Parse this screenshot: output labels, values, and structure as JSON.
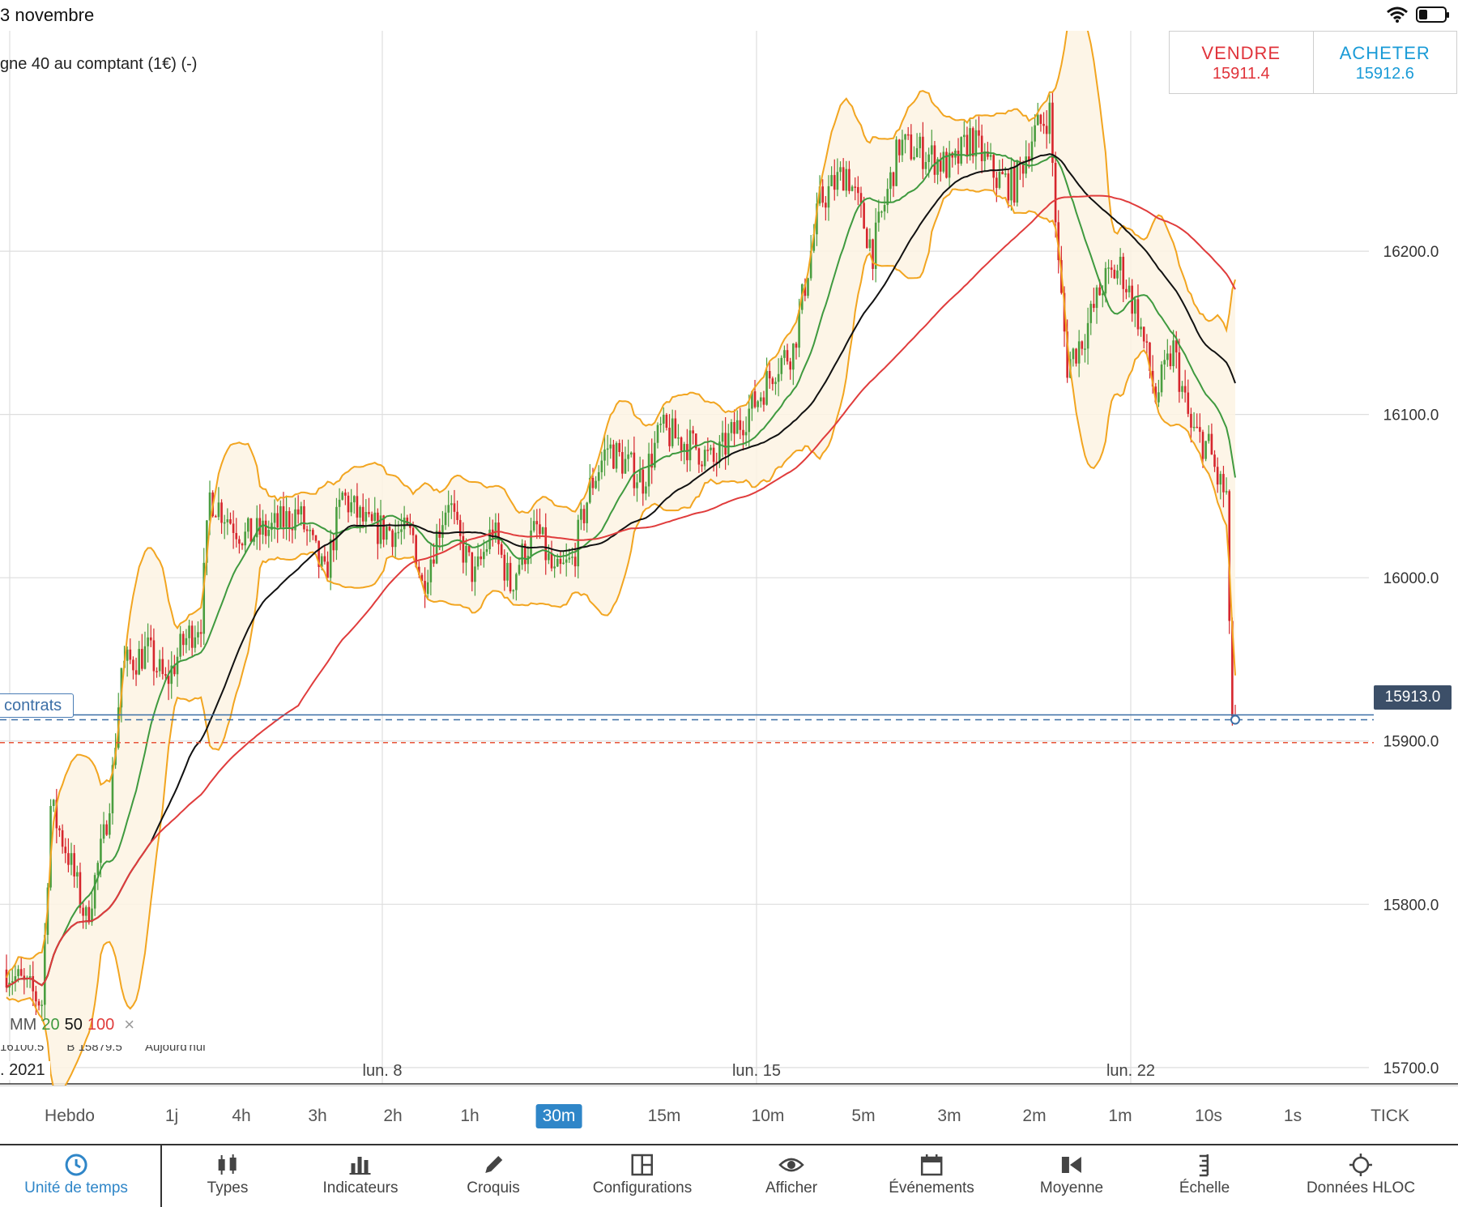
{
  "status_bar": {
    "date": "3 novembre"
  },
  "instrument": {
    "name": "gne 40 au comptant (1€) (-)"
  },
  "trade": {
    "sell_label": "VENDRE",
    "sell_price": "15911.4",
    "buy_label": "ACHETER",
    "buy_price": "15912.6"
  },
  "position": {
    "label": "contrats",
    "price_tag": "15913.0"
  },
  "ma_legend": {
    "prefix": "MM",
    "p1": "20",
    "p2": "50",
    "p3": "100",
    "close": "×"
  },
  "hloc": {
    "high": "16100.5",
    "low": "B 15879.5",
    "date": "Aujourd'hui"
  },
  "year_label": ". 2021",
  "timeframes": {
    "items": [
      "Hebdo",
      "1j",
      "4h",
      "3h",
      "2h",
      "1h",
      "30m",
      "15m",
      "10m",
      "5m",
      "3m",
      "2m",
      "1m",
      "10s",
      "1s",
      "TICK"
    ],
    "active": "30m"
  },
  "toolbar": {
    "items": [
      {
        "label": "Unité de temps",
        "icon": "clock-icon"
      },
      {
        "label": "Types",
        "icon": "candlestick-icon"
      },
      {
        "label": "Indicateurs",
        "icon": "bar-chart-icon"
      },
      {
        "label": "Croquis",
        "icon": "pencil-icon"
      },
      {
        "label": "Configurations",
        "icon": "layout-icon"
      },
      {
        "label": "Afficher",
        "icon": "eye-icon"
      },
      {
        "label": "Événements",
        "icon": "calendar-icon"
      },
      {
        "label": "Moyenne",
        "icon": "rewind-icon"
      },
      {
        "label": "Échelle",
        "icon": "scale-icon"
      },
      {
        "label": "Données HLOC",
        "icon": "crosshair-icon"
      }
    ],
    "active": "Unité de temps"
  },
  "colors": {
    "bull": "#4a9e3f",
    "bear": "#d6262d",
    "bollinger": "#f2a520",
    "ma20": "#3f9a3f",
    "ma50": "#111111",
    "ma100": "#e03c3c",
    "position_line": "#3c6fa6",
    "order_line": "#e8553a",
    "accent": "#2f86c8"
  },
  "chart_data": {
    "type": "candlestick",
    "x_ticks": [
      "lun. 8",
      "lun. 15",
      "lun. 22"
    ],
    "y_ticks": [
      "16200.0",
      "16100.0",
      "16000.0",
      "15900.0",
      "15800.0",
      "15700.0"
    ],
    "ylim": [
      15690,
      16335
    ],
    "position_price": 15913.0,
    "order_price": 15900.0,
    "last_price": 15913.0,
    "indicators": [
      "Bollinger",
      "MM 20",
      "MM 50",
      "MM 100"
    ],
    "price_path": [
      [
        0,
        15760
      ],
      [
        4,
        15740
      ],
      [
        5,
        15860
      ],
      [
        7,
        15830
      ],
      [
        9,
        15790
      ],
      [
        11,
        15840
      ],
      [
        12,
        15880
      ],
      [
        13,
        15945
      ],
      [
        16,
        15955
      ],
      [
        18,
        15935
      ],
      [
        20,
        15960
      ],
      [
        22,
        15975
      ],
      [
        23,
        16050
      ],
      [
        27,
        16025
      ],
      [
        30,
        16030
      ],
      [
        33,
        16040
      ],
      [
        36,
        16000
      ],
      [
        38,
        16050
      ],
      [
        41,
        16030
      ],
      [
        43,
        16030
      ],
      [
        46,
        16025
      ],
      [
        47,
        15995
      ],
      [
        50,
        16050
      ],
      [
        51,
        16025
      ],
      [
        53,
        16000
      ],
      [
        55,
        16030
      ],
      [
        57,
        15995
      ],
      [
        58,
        16010
      ],
      [
        60,
        16030
      ],
      [
        62,
        16000
      ],
      [
        64,
        16010
      ],
      [
        66,
        16055
      ],
      [
        68,
        16080
      ],
      [
        72,
        16060
      ],
      [
        74,
        16090
      ],
      [
        78,
        16080
      ],
      [
        80,
        16070
      ],
      [
        83,
        16095
      ],
      [
        85,
        16110
      ],
      [
        87,
        16130
      ],
      [
        89,
        16140
      ],
      [
        92,
        16230
      ],
      [
        95,
        16250
      ],
      [
        98,
        16200
      ],
      [
        101,
        16265
      ],
      [
        104,
        16260
      ],
      [
        107,
        16250
      ],
      [
        109,
        16270
      ],
      [
        112,
        16245
      ],
      [
        114,
        16240
      ],
      [
        116,
        16270
      ],
      [
        118,
        16285
      ],
      [
        119,
        16190
      ],
      [
        120,
        16130
      ],
      [
        122,
        16150
      ],
      [
        124,
        16180
      ],
      [
        126,
        16190
      ],
      [
        128,
        16160
      ],
      [
        130,
        16110
      ],
      [
        132,
        16140
      ],
      [
        134,
        16090
      ],
      [
        136,
        16080
      ],
      [
        137,
        16060
      ],
      [
        138,
        16050
      ],
      [
        138.5,
        15920
      ],
      [
        139,
        15913
      ]
    ]
  }
}
